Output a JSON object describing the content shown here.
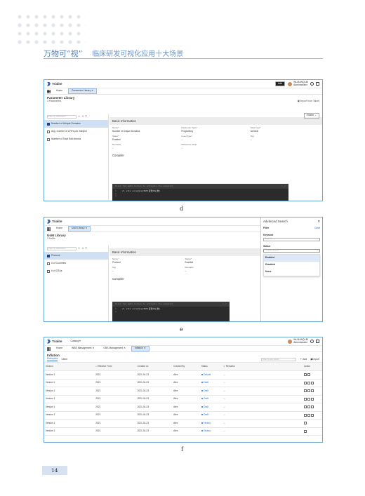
{
  "header": {
    "title": "万物可“视”",
    "subtitle": "临床研发可视化应用十大场景"
  },
  "figures": {
    "d": {
      "caption": "d",
      "brand": "Trialite",
      "add": "Add",
      "user": "WUJIANQLIN",
      "role": "Administrator",
      "tabs": [
        "Home",
        "Parameter Library"
      ],
      "title": "Parameter Library",
      "count": "3 Parameters",
      "import": "Import from Tainet",
      "search_placeholder": "Filter by code/name",
      "enable": "Enable",
      "items": [
        "Number of Unique Domains",
        "Avg. number of CRFs per Subject",
        "Number of Total Edit checks"
      ],
      "section": "Basic Information",
      "fields": [
        [
          "Name*",
          "Number of Unique Domains"
        ],
        [
          "Parameter Type*",
          "Programing"
        ],
        [
          "Data Type*",
          "General"
        ],
        [
          "Status*",
          "Enabled"
        ],
        [
          "Level Type*",
          "--"
        ],
        [
          "Tag",
          "--"
        ],
        [
          "Remarks",
          "--"
        ],
        [
          "Reference value",
          "--"
        ]
      ],
      "compiler": "Compiler",
      "code_hint": "Click the Edit button to activate the compiler",
      "code_lines": [
        "1",
        "2",
        "3"
      ],
      "code_text": "cl site encoding=SUM(变量中心数)"
    },
    "e": {
      "caption": "e",
      "brand": "Trialite",
      "tabs": [
        "Home",
        "UoM Library"
      ],
      "title": "UoM Library",
      "count": "3 UoMs",
      "search_placeholder": "Filter by code/name",
      "items": [
        "Protocol",
        "# of Countries",
        "# of CRAs"
      ],
      "section": "Basic Information",
      "fields": [
        [
          "Name *",
          "Protocol"
        ],
        [
          "Status*",
          "Enabled"
        ],
        [
          "Tag",
          "--"
        ],
        [
          "Remarks",
          "--"
        ]
      ],
      "compiler": "Compiler",
      "code_hint": "Click the Edit button to activate the compiler",
      "code_lines": [
        "1",
        "2"
      ],
      "code_text": "cl site encoding=SUM(变量中心数)",
      "adv": {
        "title": "Advanced Search",
        "filter": "Filter",
        "clear": "Clear",
        "keyword": "Keyword",
        "keyword_ph": "Search",
        "status": "Status",
        "status_ph": "Please select",
        "options": [
          "Enabled",
          "Disabled",
          "None"
        ]
      }
    },
    "f": {
      "caption": "f",
      "brand": "Trialite",
      "catalog": "Catalog",
      "user": "WUJIANQLIN",
      "role": "Administrator",
      "tabs": [
        "Home",
        "WBS Management",
        "OBS Management",
        "Inflation"
      ],
      "title": "Inflation",
      "subtabs": [
        "Enterprise",
        "Client"
      ],
      "search_placeholder": "Filter by key words",
      "add": "Add",
      "import": "Import",
      "columns": [
        "Version",
        "Effective From",
        "Created on",
        "Created By",
        "Status",
        "Remarks",
        "Action"
      ],
      "rows": [
        [
          "Version 1",
          "2021",
          "2021-04-23",
          "Alex",
          "Default",
          "--"
        ],
        [
          "Version 1",
          "2021",
          "2021-04-23",
          "Alex",
          "Draft",
          "--"
        ],
        [
          "Version 1",
          "2021",
          "2021-04-23",
          "Alex",
          "Draft",
          "--"
        ],
        [
          "Version 1",
          "2021",
          "2021-04-23",
          "Alex",
          "Draft",
          "--"
        ],
        [
          "Version 1",
          "2021",
          "2021-04-23",
          "Alex",
          "Draft",
          "--"
        ],
        [
          "Version 1",
          "2021",
          "2021-04-23",
          "Alex",
          "Draft",
          "--"
        ],
        [
          "Version 1",
          "2021",
          "2021-04-23",
          "Alex",
          "History",
          "--"
        ],
        [
          "Version 1",
          "2021",
          "2021-04-23",
          "Alex",
          "History",
          "--"
        ]
      ]
    }
  },
  "page_number": "14"
}
